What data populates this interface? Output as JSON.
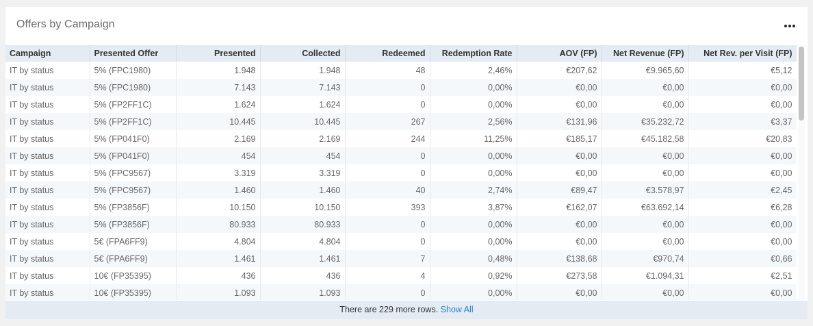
{
  "panel": {
    "title": "Offers by Campaign",
    "menu_icon": "more-horizontal-icon"
  },
  "table": {
    "columns": [
      {
        "key": "campaign",
        "label": "Campaign",
        "align": "l"
      },
      {
        "key": "offer",
        "label": "Presented Offer",
        "align": "l"
      },
      {
        "key": "presented",
        "label": "Presented",
        "align": "r"
      },
      {
        "key": "collected",
        "label": "Collected",
        "align": "r"
      },
      {
        "key": "redeemed",
        "label": "Redeemed",
        "align": "r"
      },
      {
        "key": "redemption_rate",
        "label": "Redemption Rate",
        "align": "r"
      },
      {
        "key": "aov",
        "label": "AOV (FP)",
        "align": "r"
      },
      {
        "key": "net_revenue",
        "label": "Net Revenue (FP)",
        "align": "r"
      },
      {
        "key": "net_rev_per_visit",
        "label": "Net Rev. per Visit (FP)",
        "align": "r"
      }
    ],
    "rows": [
      [
        "IT by status",
        "5% (FPC1980)",
        "1.948",
        "1.948",
        "48",
        "2,46%",
        "€207,62",
        "€9.965,60",
        "€5,12"
      ],
      [
        "IT by status",
        "5% (FPC1980)",
        "7.143",
        "7.143",
        "0",
        "0,00%",
        "€0,00",
        "€0,00",
        "€0,00"
      ],
      [
        "IT by status",
        "5% (FP2FF1C)",
        "1.624",
        "1.624",
        "0",
        "0,00%",
        "€0,00",
        "€0,00",
        "€0,00"
      ],
      [
        "IT by status",
        "5% (FP2FF1C)",
        "10.445",
        "10.445",
        "267",
        "2,56%",
        "€131,96",
        "€35.232,72",
        "€3,37"
      ],
      [
        "IT by status",
        "5% (FP041F0)",
        "2.169",
        "2.169",
        "244",
        "11,25%",
        "€185,17",
        "€45.182,58",
        "€20,83"
      ],
      [
        "IT by status",
        "5% (FP041F0)",
        "454",
        "454",
        "0",
        "0,00%",
        "€0,00",
        "€0,00",
        "€0,00"
      ],
      [
        "IT by status",
        "5% (FPC9567)",
        "3.319",
        "3.319",
        "0",
        "0,00%",
        "€0,00",
        "€0,00",
        "€0,00"
      ],
      [
        "IT by status",
        "5% (FPC9567)",
        "1.460",
        "1.460",
        "40",
        "2,74%",
        "€89,47",
        "€3.578,97",
        "€2,45"
      ],
      [
        "IT by status",
        "5% (FP3856F)",
        "10.150",
        "10.150",
        "393",
        "3,87%",
        "€162,07",
        "€63.692,14",
        "€6,28"
      ],
      [
        "IT by status",
        "5% (FP3856F)",
        "80.933",
        "80.933",
        "0",
        "0,00%",
        "€0,00",
        "€0,00",
        "€0,00"
      ],
      [
        "IT by status",
        "5€ (FPA6FF9)",
        "4.804",
        "4.804",
        "0",
        "0,00%",
        "€0,00",
        "€0,00",
        "€0,00"
      ],
      [
        "IT by status",
        "5€ (FPA6FF9)",
        "1.461",
        "1.461",
        "7",
        "0,48%",
        "€138,68",
        "€970,74",
        "€0,66"
      ],
      [
        "IT by status",
        "10€ (FP35395)",
        "436",
        "436",
        "4",
        "0,92%",
        "€273,58",
        "€1.094,31",
        "€2,51"
      ],
      [
        "IT by status",
        "10€ (FP35395)",
        "1.093",
        "1.093",
        "0",
        "0,00%",
        "€0,00",
        "€0,00",
        "€0,00"
      ]
    ]
  },
  "scrollbar": {
    "position_fraction": 0.0
  },
  "footer": {
    "message": "There are 229 more rows.",
    "link_label": "Show All"
  },
  "colors": {
    "header_bg": "#e4ebf3",
    "link": "#2b7fd2",
    "row_alt": "#f5f8fb"
  }
}
